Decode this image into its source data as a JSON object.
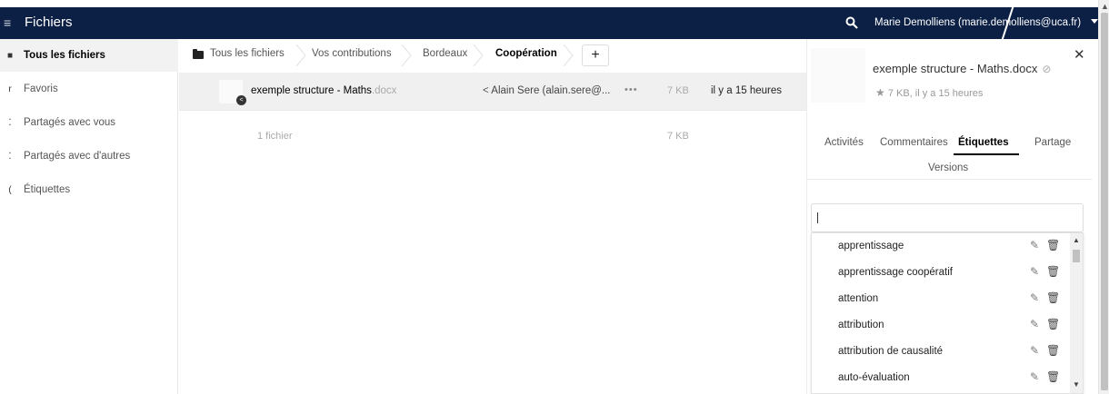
{
  "header": {
    "app_title": "Fichiers",
    "user_label": "Marie Demolliens (marie.demolliens@uca.fr)",
    "background": "#0c2046"
  },
  "sidebar": {
    "items": [
      {
        "label": "Tous les fichiers",
        "icon": "folder-icon"
      },
      {
        "label": "Favoris",
        "icon": "star-icon"
      },
      {
        "label": "Partagés avec vous",
        "icon": "share-icon"
      },
      {
        "label": "Partagés avec d'autres",
        "icon": "share-icon"
      },
      {
        "label": "Étiquettes",
        "icon": "tag-icon"
      }
    ]
  },
  "breadcrumb": {
    "items": [
      "Tous les fichiers",
      "Vos contributions",
      "Bordeaux",
      "Coopération"
    ],
    "add_label": "+"
  },
  "file": {
    "name": "exemple structure - Maths",
    "extension": ".docx",
    "shared_with": "Alain Sere (alain.sere@...",
    "more": "•••",
    "size": "7 KB",
    "modified": "il y a 15 heures"
  },
  "summary": {
    "count": "1 fichier",
    "size": "7 KB"
  },
  "details": {
    "title": "exemple structure - Maths.docx",
    "meta": "7 KB, il y a 15 heures",
    "tabs": [
      "Activités",
      "Commentaires",
      "Étiquettes",
      "Partage",
      "Versions"
    ],
    "active_tab": "Étiquettes",
    "tag_input_value": "",
    "tags": [
      "apprentissage",
      "apprentissage coopératif",
      "attention",
      "attribution",
      "attribution de causalité",
      "auto-évaluation"
    ]
  }
}
